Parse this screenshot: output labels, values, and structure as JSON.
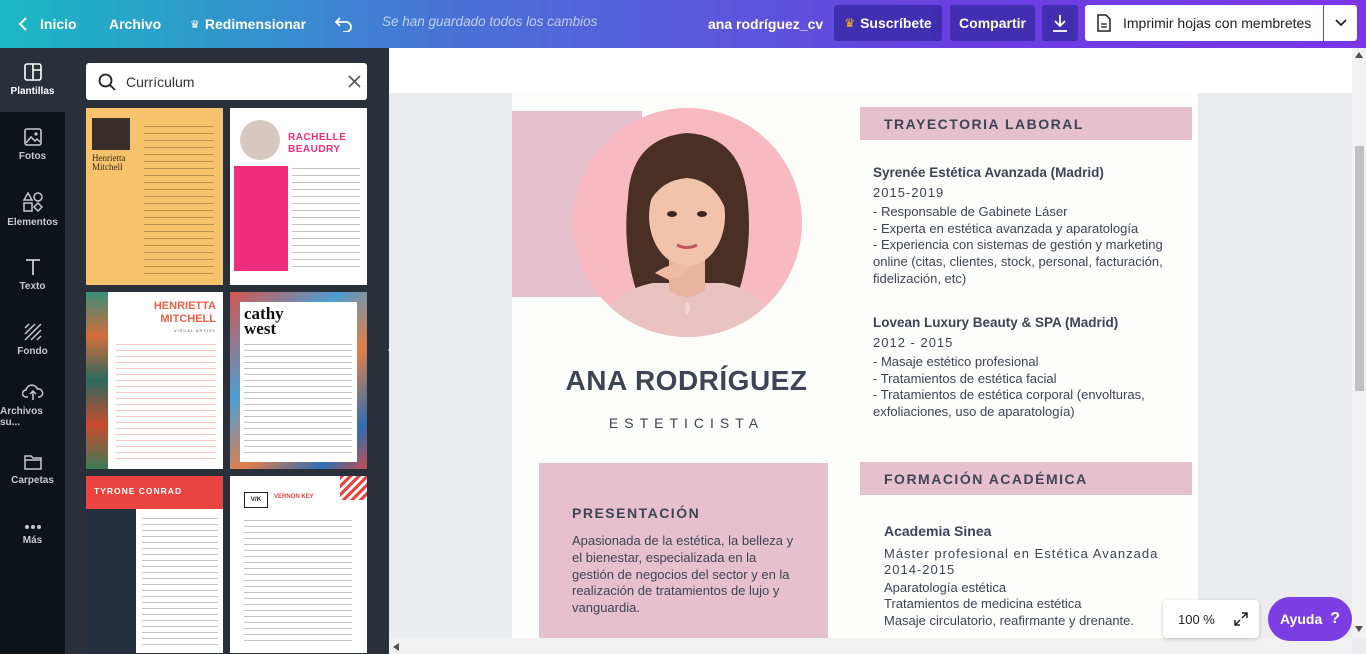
{
  "topbar": {
    "back_label": "Inicio",
    "file_label": "Archivo",
    "resize_label": "Redimensionar",
    "saved_status": "Se han guardado todos los cambios",
    "document_title": "ana rodríguez_cv",
    "subscribe_label": "Suscríbete",
    "share_label": "Compartir",
    "print_label": "Imprimir hojas con membretes"
  },
  "sidebar": {
    "items": [
      {
        "label": "Plantillas",
        "icon": "templates-icon"
      },
      {
        "label": "Fotos",
        "icon": "photos-icon"
      },
      {
        "label": "Elementos",
        "icon": "elements-icon"
      },
      {
        "label": "Texto",
        "icon": "text-icon"
      },
      {
        "label": "Fondo",
        "icon": "background-icon"
      },
      {
        "label": "Archivos su...",
        "icon": "upload-icon"
      },
      {
        "label": "Carpetas",
        "icon": "folder-icon"
      },
      {
        "label": "Más",
        "icon": "more-icon"
      }
    ]
  },
  "search": {
    "value": "Currículum",
    "placeholder": ""
  },
  "templates": [
    {
      "name": "Henrietta\nMitchell",
      "color": "#f6c26b"
    },
    {
      "name": "RACHELLE BEAUDRY",
      "color": "#ef2d7a"
    },
    {
      "name": "HENRIETTA MITCHELL",
      "subtitle": "VISUAL ARTIST",
      "color": "#e8604a"
    },
    {
      "name": "cathy west",
      "color": "#d7554e"
    },
    {
      "name": "TYRONE CONRAD",
      "color": "#e9443f"
    },
    {
      "name": "V/K",
      "name2": "VERNON KEY",
      "color": "#e9443f"
    }
  ],
  "resume": {
    "name": "ANA RODRÍGUEZ",
    "role": "ESTETICISTA",
    "presentation_title": "PRESENTACIÓN",
    "presentation_text": "Apasionada de la estética, la belleza y el bienestar, especializada en la gestión de negocios del sector y en la realización de tratamientos de lujo y vanguardia.",
    "work_title": "TRAYECTORIA LABORAL",
    "jobs": [
      {
        "company": "Syrenée Estética Avanzada (Madrid)",
        "years": "2015-2019",
        "lines": [
          "- Responsable de Gabinete Láser",
          "- Experta en estética avanzada y aparatología",
          "- Experiencia con sistemas de gestión y marketing online (citas, clientes, stock, personal, facturación, fidelización, etc)"
        ]
      },
      {
        "company": "Lovean Luxury Beauty & SPA (Madrid)",
        "years": "2012 - 2015",
        "lines": [
          "- Masaje estético profesional",
          "- Tratamientos de estética facial",
          "- Tratamientos de estética corporal (envolturas, exfoliaciones, uso de aparatología)"
        ]
      }
    ],
    "education_title": "FORMACIÓN ACADÉMICA",
    "education": {
      "school": "Academia Sinea",
      "degree": "Máster profesional en Estética Avanzada",
      "years": "2014-2015",
      "lines": [
        "Aparatología estética",
        "Tratamientos de medicina estética",
        "Masaje circulatorio, reafirmante y drenante."
      ]
    }
  },
  "zoom": {
    "value": "100 %"
  },
  "help": {
    "label": "Ayuda"
  },
  "colors": {
    "accent": "#7c3ee2",
    "resume_pink": "#e6c1cd",
    "resume_text": "#3d4454"
  }
}
